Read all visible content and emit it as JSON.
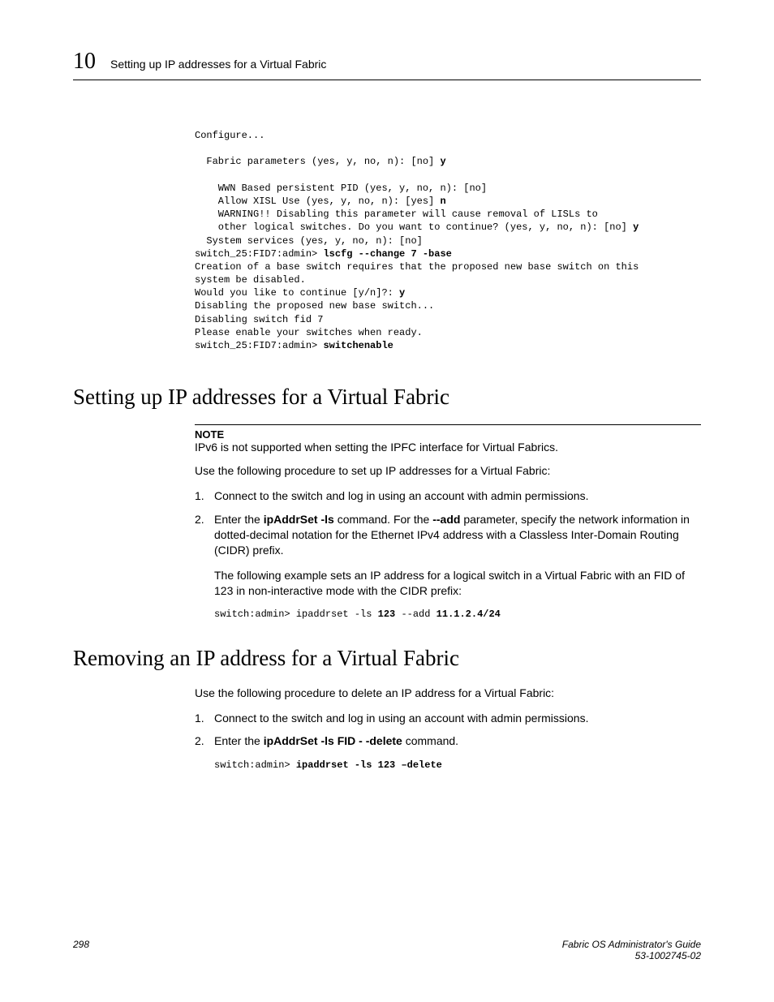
{
  "header": {
    "chapter": "10",
    "title": "Setting up IP addresses for a Virtual Fabric"
  },
  "codeBlock": {
    "l1": "Configure...",
    "l2": "",
    "l3": "  Fabric parameters (yes, y, no, n): [no] ",
    "l3b": "y",
    "l4": "",
    "l5": "    WWN Based persistent PID (yes, y, no, n): [no]",
    "l6": "    Allow XISL Use (yes, y, no, n): [yes] ",
    "l6b": "n",
    "l7": "    WARNING!! Disabling this parameter will cause removal of LISLs to",
    "l8": "    other logical switches. Do you want to continue? (yes, y, no, n): [no] ",
    "l8b": "y",
    "l9": "  System services (yes, y, no, n): [no]",
    "l10": "switch_25:FID7:admin> ",
    "l10b": "lscfg --change 7 -base",
    "l11": "Creation of a base switch requires that the proposed new base switch on this",
    "l12": "system be disabled.",
    "l13": "Would you like to continue [y/n]?: ",
    "l13b": "y",
    "l14": "Disabling the proposed new base switch...",
    "l15": "Disabling switch fid 7",
    "l16": "Please enable your switches when ready.",
    "l17": "switch_25:FID7:admin> ",
    "l17b": "switchenable"
  },
  "section1": {
    "heading": "Setting up IP addresses for a Virtual Fabric",
    "noteLabel": "NOTE",
    "noteText": "IPv6 is not supported when setting the IPFC interface for Virtual Fabrics.",
    "intro": "Use the following procedure to set up IP addresses for a Virtual Fabric:",
    "step1num": "1.",
    "step1": "Connect to the switch and log in using an account with admin permissions.",
    "step2num": "2.",
    "step2a": "Enter the ",
    "step2cmd1": "ipAddrSet -ls",
    "step2b": " command. For the  ",
    "step2cmd2": "--add",
    "step2c": " parameter, specify the network information in dotted-decimal notation for the Ethernet IPv4 address with a Classless Inter-Domain Routing (CIDR) prefix.",
    "step2para": "The following example sets an IP address for a logical switch in a Virtual Fabric with an FID of 123 in non-interactive mode with the CIDR prefix:",
    "step2code_a": "switch:admin> ipaddrset -ls ",
    "step2code_b": "123",
    "step2code_c": " --add ",
    "step2code_d": "11.1.2.4/24"
  },
  "section2": {
    "heading": "Removing an IP address for a Virtual Fabric",
    "intro": "Use the following procedure to delete an IP address for a Virtual Fabric:",
    "step1num": "1.",
    "step1": "Connect to the switch and log in using an account with admin permissions.",
    "step2num": "2.",
    "step2a": "Enter the ",
    "step2cmd": "ipAddrSet -ls FID - -delete",
    "step2b": " command.",
    "step2code_a": "switch:admin> ",
    "step2code_b": "ipaddrset -ls 123 –delete"
  },
  "footer": {
    "pageNum": "298",
    "guide": "Fabric OS Administrator's Guide",
    "docnum": "53-1002745-02"
  }
}
